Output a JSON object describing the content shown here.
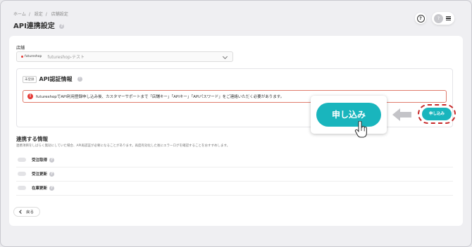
{
  "breadcrumb": [
    "ホーム",
    "設定",
    "店舗設定"
  ],
  "page": {
    "title": "API連携設定"
  },
  "header": {
    "avatar_initial": "?"
  },
  "store": {
    "label": "店舗",
    "badge": "futureshop",
    "selected": "futureshop-テスト"
  },
  "auth": {
    "status_badge": "未登録",
    "title": "API認証情報",
    "alert": "futureshopでAPI利用登録申し込み後、カスタマーサポートまで「店舗キー」「APIキー」「APIパスワード」をご連絡いただく必要があります。",
    "apply_label": "申し込み"
  },
  "callout": {
    "apply_label": "申し込み"
  },
  "sync": {
    "title": "連携する情報",
    "description": "連携項目をしばらく無効にしていた場合、API再認証が必要になることがあります。再度有効化した後にエラーログを確認することをおすすめします。",
    "items": [
      {
        "label": "受注取得"
      },
      {
        "label": "受注更新"
      },
      {
        "label": "在庫更新"
      }
    ]
  },
  "back_label": "戻る",
  "colors": {
    "accent": "#19b5bd",
    "alert": "#e53935",
    "highlight": "#c62828"
  },
  "icons": [
    "help-icon",
    "menu-icon",
    "chevron-down-icon",
    "alert-icon",
    "arrow-left-icon",
    "hand-cursor-icon",
    "chevron-left-icon"
  ]
}
